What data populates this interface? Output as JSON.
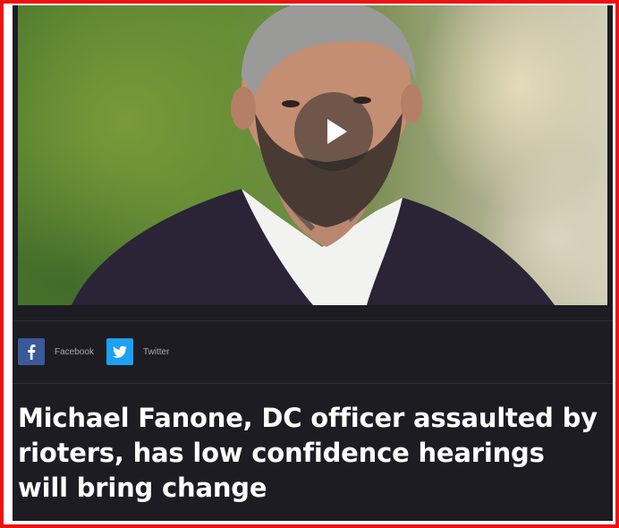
{
  "video": {
    "play_icon": "play-icon"
  },
  "share": {
    "facebook": {
      "icon": "facebook-icon",
      "label": "Facebook",
      "color": "#3b5998"
    },
    "twitter": {
      "icon": "twitter-icon",
      "label": "Twitter",
      "color": "#1da1f2"
    }
  },
  "article": {
    "headline": "Michael Fanone, DC officer assaulted by rioters, has low confidence hearings will bring change"
  },
  "colors": {
    "frame_border": "#ee1111",
    "background": "#1c1c22",
    "text": "#ffffff"
  }
}
